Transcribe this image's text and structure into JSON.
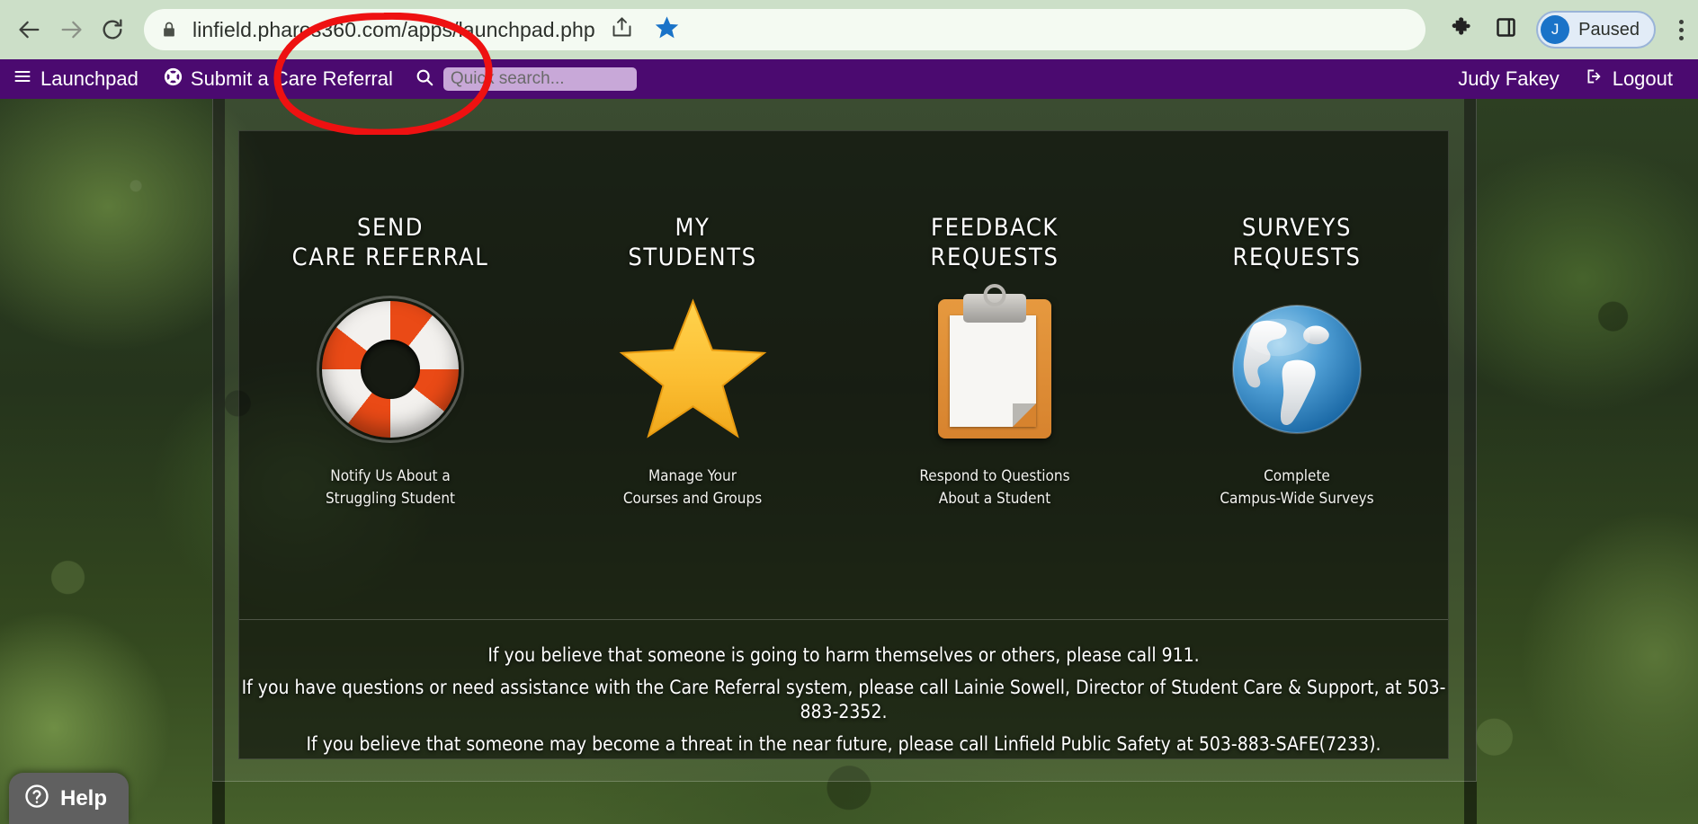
{
  "browser": {
    "url": "linfield.pharos360.com/apps/launchpad.php",
    "back_icon": "back-arrow-icon",
    "forward_icon": "forward-arrow-icon",
    "reload_icon": "reload-icon",
    "lock_icon": "lock-icon",
    "share_icon": "share-icon",
    "bookmark_icon": "star-icon",
    "extensions_icon": "puzzle-piece-icon",
    "side_panel_icon": "side-panel-icon",
    "profile_initial": "J",
    "profile_status": "Paused",
    "menu_icon": "three-dot-menu-icon",
    "bookmark_color": "#1a73c8",
    "toolbar_bg": "#ccdfc8"
  },
  "app_nav": {
    "bg_color": "#4b0a70",
    "launchpad_label": "Launchpad",
    "launchpad_icon": "hamburger-menu-icon",
    "referral_label": "Submit a Care Referral",
    "referral_icon": "life-ring-icon",
    "search_icon": "search-icon",
    "search_placeholder": "Quick search...",
    "search_value": "",
    "user_name": "Judy Fakey",
    "logout_label": "Logout",
    "logout_icon": "sign-out-icon"
  },
  "tiles": [
    {
      "title": "SEND\nCARE REFERRAL",
      "subtitle": "Notify Us About a\nStruggling Student",
      "icon": "life-ring-icon"
    },
    {
      "title": "MY\nSTUDENTS",
      "subtitle": "Manage Your\nCourses and Groups",
      "icon": "star-icon"
    },
    {
      "title": "FEEDBACK\nREQUESTS",
      "subtitle": "Respond to Questions\nAbout a Student",
      "icon": "clipboard-icon"
    },
    {
      "title": "SURVEYS\nREQUESTS",
      "subtitle": "Complete\nCampus-Wide Surveys",
      "icon": "globe-icon"
    }
  ],
  "notices": [
    "If you believe that someone is going to harm themselves or others, please call 911.",
    "If you have questions or need assistance with the Care Referral system, please call Lainie Sowell, Director of Student Care & Support, at 503-883-2352.",
    "If you believe that someone may become a threat in the near future, please call Linfield Public Safety at 503-883-SAFE(7233)."
  ],
  "help": {
    "label": "Help",
    "icon": "question-mark-circle-icon"
  },
  "annotation": {
    "shape": "hand-drawn-red-ellipse",
    "color": "#ee1111",
    "target": "quick-search-input"
  }
}
